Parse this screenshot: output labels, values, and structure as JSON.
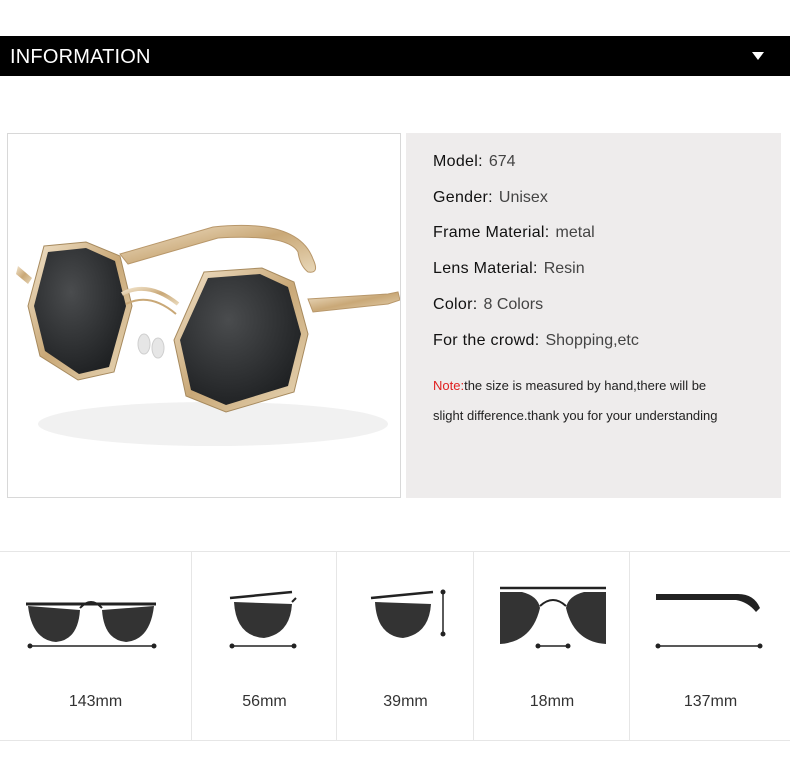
{
  "header": {
    "title": "INFORMATION",
    "toggle_icon": "triangle-down-icon"
  },
  "product_image": {
    "alt": "gold octagon frame sunglasses with dark grey lenses"
  },
  "specs": [
    {
      "label": "Model:",
      "value": "674"
    },
    {
      "label": "Gender:",
      "value": "Unisex"
    },
    {
      "label": "Frame Material:",
      "value": "metal"
    },
    {
      "label": "Lens Material:",
      "value": "Resin"
    },
    {
      "label": "Color:",
      "value": "8 Colors"
    },
    {
      "label": "For the crowd:",
      "value": "Shopping,etc"
    }
  ],
  "note": {
    "label": "Note:",
    "text": "the size is measured by hand,there will be slight difference.thank you for your understanding"
  },
  "measurements": [
    {
      "value": "143mm"
    },
    {
      "value": "56mm"
    },
    {
      "value": "39mm"
    },
    {
      "value": "18mm"
    },
    {
      "value": "137mm"
    }
  ],
  "colors": {
    "header_bg": "#000000",
    "info_bg": "#eeecec",
    "note_label": "#e02020"
  }
}
